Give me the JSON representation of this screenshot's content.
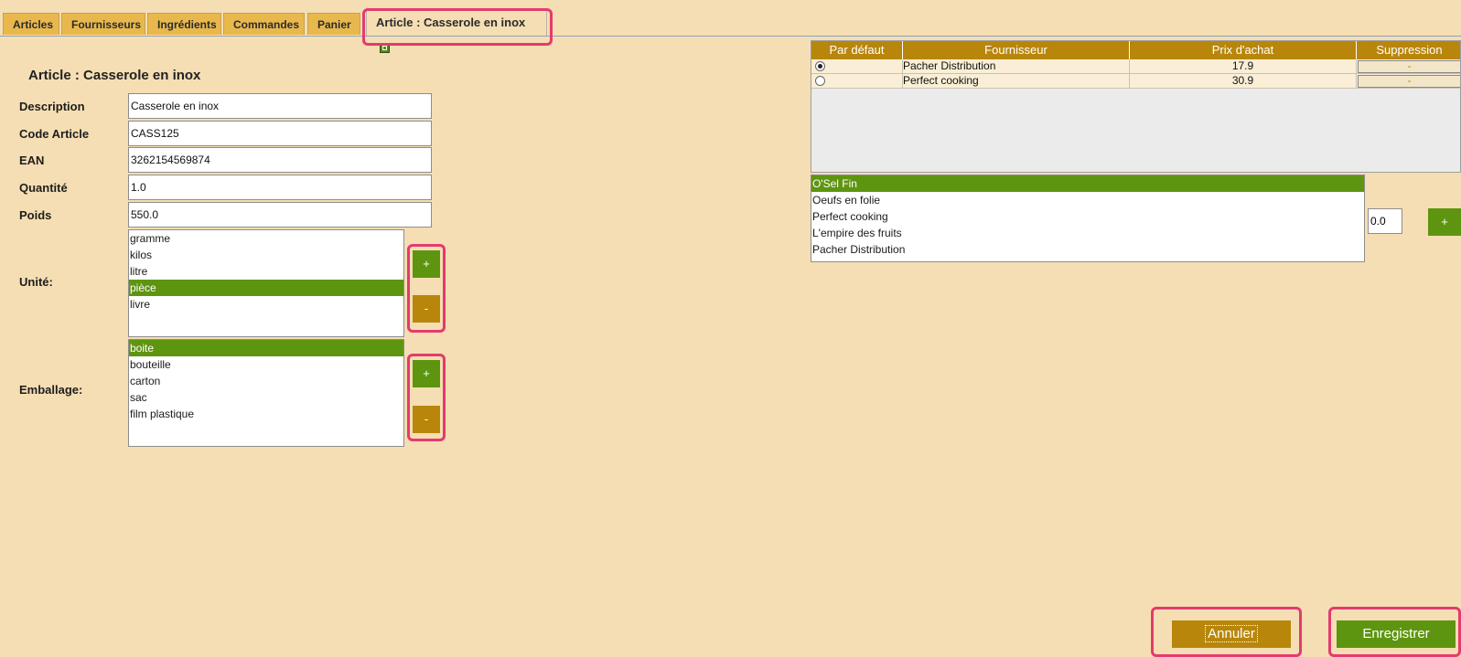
{
  "tabs": [
    {
      "label": "Articles"
    },
    {
      "label": "Fournisseurs"
    },
    {
      "label": "Ingrédients"
    },
    {
      "label": "Commandes"
    },
    {
      "label": "Panier"
    },
    {
      "label": "Article : Casserole en inox",
      "active": true
    }
  ],
  "form": {
    "title": "Article : Casserole en inox",
    "fields": [
      {
        "label": "Description",
        "value": "Casserole en inox"
      },
      {
        "label": "Code Article",
        "value": "CASS125"
      },
      {
        "label": "EAN",
        "value": "3262154569874"
      },
      {
        "label": "Quantité",
        "value": "1.0"
      },
      {
        "label": "Poids",
        "value": "550.0"
      }
    ],
    "unite": {
      "label": "Unité:",
      "options": [
        "gramme",
        "kilos",
        "litre",
        "pièce",
        "livre"
      ],
      "selected": "pièce",
      "add_label": "+",
      "remove_label": "-"
    },
    "emballage": {
      "label": "Emballage:",
      "options": [
        "boite",
        "bouteille",
        "carton",
        "sac",
        "film plastique"
      ],
      "selected": "boite",
      "add_label": "+",
      "remove_label": "-"
    }
  },
  "suppliers_table": {
    "headers": [
      "Par défaut",
      "Fournisseur",
      "Prix d'achat",
      "Suppression"
    ],
    "rows": [
      {
        "default": true,
        "fournisseur": "Pacher Distribution",
        "prix": "17.9",
        "suppression": "-"
      },
      {
        "default": false,
        "fournisseur": "Perfect cooking",
        "prix": "30.9",
        "suppression": "-"
      }
    ]
  },
  "supplier_picker": {
    "options": [
      "O'Sel Fin",
      "Oeufs en folie",
      "Perfect cooking",
      "L'empire des fruits",
      "Pacher Distribution"
    ],
    "selected": "O'Sel Fin",
    "price_value": "0.0",
    "add_label": "+"
  },
  "actions": {
    "cancel_label": "Annuler",
    "save_label": "Enregistrer"
  },
  "colors": {
    "background": "#f5deb3",
    "accent_green": "#5e9510",
    "accent_gold": "#b8860b",
    "tab_bg": "#e8b84d",
    "highlight": "#e33b6e"
  }
}
